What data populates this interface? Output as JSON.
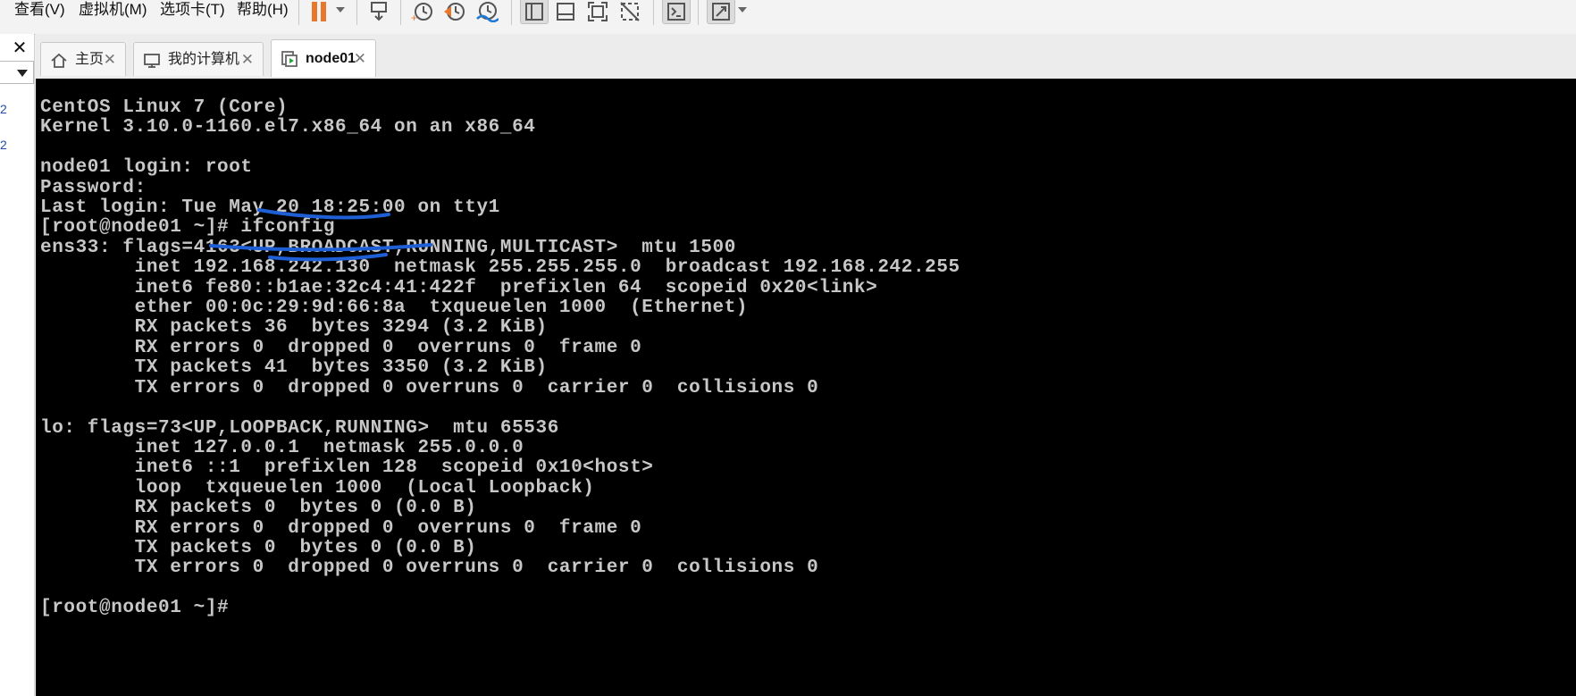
{
  "menu": {
    "view": "查看(V)",
    "vm": "虚拟机(M)",
    "tabs": "选项卡(T)",
    "help": "帮助(H)"
  },
  "toolbar": {
    "icons": [
      "pause-icon",
      "send-ctrl-alt-del-icon",
      "snapshot-take-icon",
      "snapshot-revert-icon",
      "snapshot-manager-icon",
      "show-library-icon",
      "thumbnail-bar-icon",
      "fullscreen-icon",
      "unity-icon",
      "console-view-icon",
      "autofit-icon"
    ]
  },
  "tabs": [
    {
      "label": "主页",
      "icon": "home-icon"
    },
    {
      "label": "我的计算机",
      "icon": "computer-icon"
    },
    {
      "label": "node01",
      "icon": "vm-icon",
      "active": true
    }
  ],
  "library": {
    "marks": [
      "2",
      "2"
    ]
  },
  "console": {
    "lines": [
      "CentOS Linux 7 (Core)",
      "Kernel 3.10.0-1160.el7.x86_64 on an x86_64",
      "",
      "node01 login: root",
      "Password:",
      "Last login: Tue May 20 18:25:00 on tty1",
      "[root@node01 ~]# ifconfig",
      "ens33: flags=4163<UP,BROADCAST,RUNNING,MULTICAST>  mtu 1500",
      "        inet 192.168.242.130  netmask 255.255.255.0  broadcast 192.168.242.255",
      "        inet6 fe80::b1ae:32c4:41:422f  prefixlen 64  scopeid 0x20<link>",
      "        ether 00:0c:29:9d:66:8a  txqueuelen 1000  (Ethernet)",
      "        RX packets 36  bytes 3294 (3.2 KiB)",
      "        RX errors 0  dropped 0  overruns 0  frame 0",
      "        TX packets 41  bytes 3350 (3.2 KiB)",
      "        TX errors 0  dropped 0 overruns 0  carrier 0  collisions 0",
      "",
      "lo: flags=73<UP,LOOPBACK,RUNNING>  mtu 65536",
      "        inet 127.0.0.1  netmask 255.0.0.0",
      "        inet6 ::1  prefixlen 128  scopeid 0x10<host>",
      "        loop  txqueuelen 1000  (Local Loopback)",
      "        RX packets 0  bytes 0 (0.0 B)",
      "        RX errors 0  dropped 0  overruns 0  frame 0",
      "        TX packets 0  bytes 0 (0.0 B)",
      "        TX errors 0  dropped 0 overruns 0  carrier 0  collisions 0",
      "",
      "[root@node01 ~]#"
    ]
  },
  "colors": {
    "console_bg": "#000000",
    "console_fg": "#c7c7c7",
    "pause_accent": "#e8772e",
    "annotation_ink": "#1f5fd6"
  }
}
